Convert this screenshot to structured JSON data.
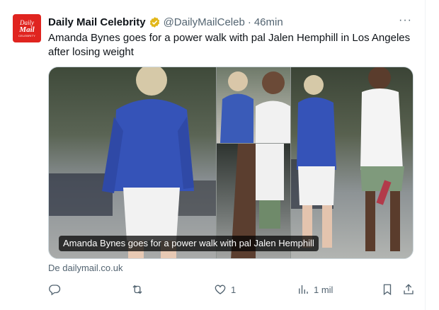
{
  "tweet": {
    "avatar": {
      "line1": "Daily",
      "line2": "Mail",
      "line3": "CELEBRITY"
    },
    "display_name": "Daily Mail Celebrity",
    "handle": "@DailyMailCeleb",
    "separator": "·",
    "time": "46min",
    "more": "···",
    "text": "Amanda Bynes goes for a power walk with pal Jalen Hemphill in Los Angeles after losing weight",
    "media": {
      "caption": "Amanda Bynes goes for a power walk with pal Jalen Hemphill"
    },
    "source": "De dailymail.co.uk",
    "actions": {
      "reply_count": "",
      "retweet_count": "",
      "like_count": "1",
      "views_count": "1 mil"
    }
  },
  "colors": {
    "text": "#0f1419",
    "secondary": "#536471",
    "brand_red": "#e0241f",
    "verified_gold": "#e2b719"
  },
  "icons": [
    "verified-badge-icon",
    "more-icon",
    "reply-icon",
    "retweet-icon",
    "like-icon",
    "views-icon",
    "bookmark-icon",
    "share-icon"
  ]
}
